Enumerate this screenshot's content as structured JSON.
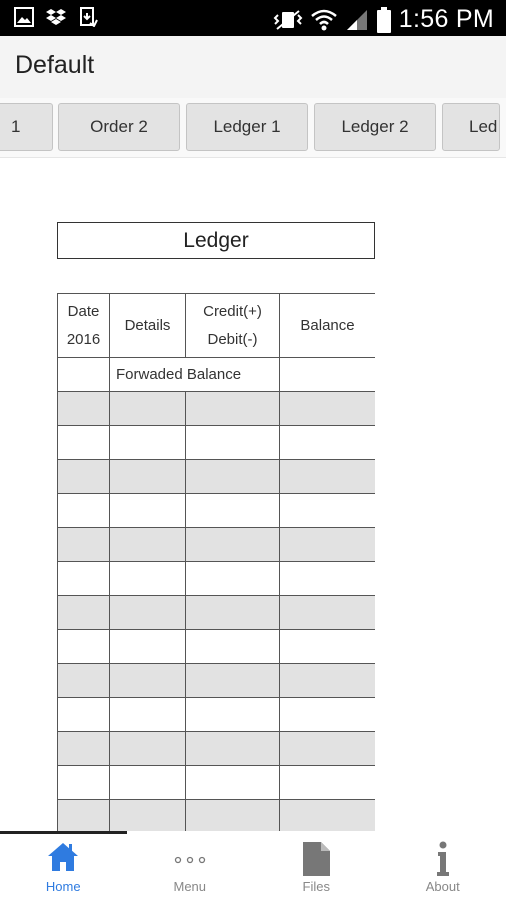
{
  "status_bar": {
    "time": "1:56 PM",
    "left_icons": [
      "image-icon",
      "dropbox-icon",
      "download-icon"
    ],
    "right_icons": [
      "vibrate-icon",
      "wifi-icon",
      "signal-icon",
      "battery-icon"
    ]
  },
  "app": {
    "title": "Default"
  },
  "tabs": [
    {
      "label": "1"
    },
    {
      "label": "Order 2"
    },
    {
      "label": "Ledger 1"
    },
    {
      "label": "Ledger 2"
    },
    {
      "label": "Led"
    }
  ],
  "ledger": {
    "title": "Ledger",
    "columns": {
      "date": [
        "Date",
        "2016"
      ],
      "details": "Details",
      "credit_debit": [
        "Credit(+)",
        "Debit(-)"
      ],
      "balance": "Balance"
    },
    "forwarded_label": "Forwaded Balance"
  },
  "bottom_nav": {
    "items": [
      {
        "label": "Home",
        "icon": "home-icon",
        "active": true
      },
      {
        "label": "Menu",
        "icon": "more-dots-icon",
        "active": false
      },
      {
        "label": "Files",
        "icon": "file-icon",
        "active": false
      },
      {
        "label": "About",
        "icon": "info-icon",
        "active": false
      }
    ]
  },
  "colors": {
    "accent": "#2f7be0",
    "status_bar_bg": "#000000",
    "header_bg": "#f4f4f4",
    "tab_bg": "#e3e3e3",
    "row_alt_bg": "#e2e2e2"
  }
}
